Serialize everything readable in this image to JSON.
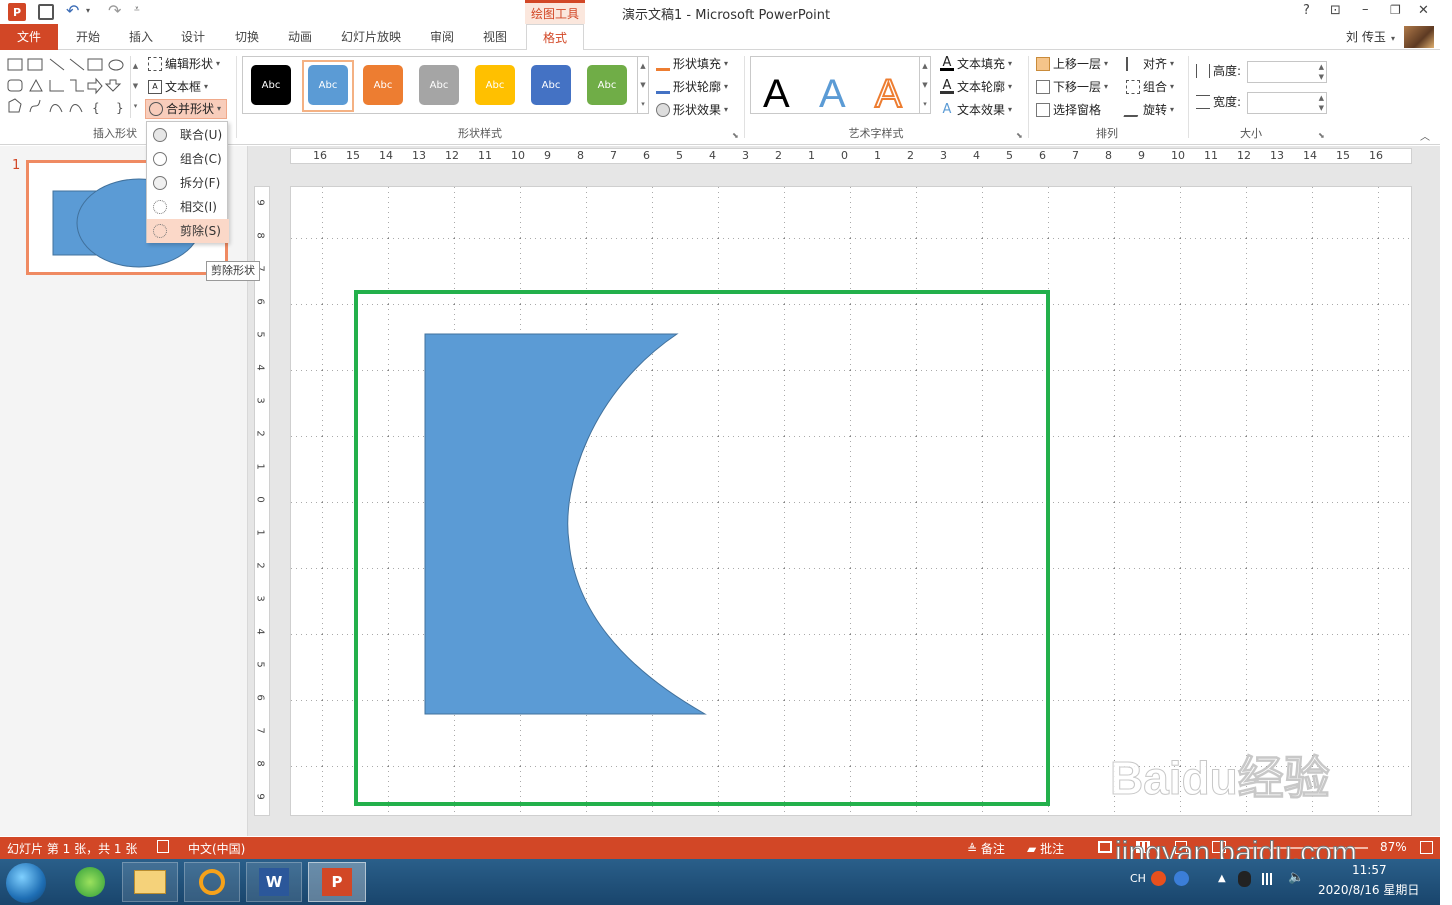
{
  "title": {
    "context_tab": "绘图工具",
    "window_title": "演示文稿1 - Microsoft PowerPoint",
    "help": "?",
    "restore_ribbon": "⊡",
    "minimize": "–",
    "maximize": "❐",
    "close": "✕"
  },
  "tabs": [
    "文件",
    "开始",
    "插入",
    "设计",
    "切换",
    "动画",
    "幻灯片放映",
    "审阅",
    "视图",
    "格式"
  ],
  "user": "刘 传玉",
  "ribbon": {
    "insert_shapes": {
      "label": "插入形状",
      "edit_shape": "编辑形状",
      "text_box": "文本框",
      "merge_shapes": "合并形状"
    },
    "shape_styles": {
      "label": "形状样式",
      "swatch_text": "Abc",
      "fill": "形状填充",
      "outline": "形状轮廓",
      "effects": "形状效果"
    },
    "wordart": {
      "label": "艺术字样式",
      "letter": "A",
      "text_fill": "文本填充",
      "text_outline": "文本轮廓",
      "text_effects": "文本效果"
    },
    "arrange": {
      "label": "排列",
      "bring_forward": "上移一层",
      "send_backward": "下移一层",
      "selection_pane": "选择窗格",
      "align": "对齐",
      "group": "组合",
      "rotate": "旋转"
    },
    "size": {
      "label": "大小",
      "height_label": "高度:",
      "width_label": "宽度:"
    }
  },
  "merge_menu": {
    "items": [
      "联合(U)",
      "组合(C)",
      "拆分(F)",
      "相交(I)",
      "剪除(S)"
    ],
    "tooltip": "剪除形状"
  },
  "slide_panel": {
    "slide_number": "1"
  },
  "hruler": [
    "16",
    "15",
    "14",
    "13",
    "12",
    "11",
    "10",
    "9",
    "8",
    "7",
    "6",
    "5",
    "4",
    "3",
    "2",
    "1",
    "0",
    "1",
    "2",
    "3",
    "4",
    "5",
    "6",
    "7",
    "8",
    "9",
    "10",
    "11",
    "12",
    "13",
    "14",
    "15",
    "16"
  ],
  "vruler": [
    "9",
    "8",
    "7",
    "6",
    "5",
    "4",
    "3",
    "2",
    "1",
    "0",
    "1",
    "2",
    "3",
    "4",
    "5",
    "6",
    "7",
    "8",
    "9"
  ],
  "status": {
    "slide_info": "幻灯片 第 1 张，共 1 张",
    "language": "中文(中国)",
    "notes": "备注",
    "comments": "批注",
    "zoom": "87%"
  },
  "watermark": {
    "brand": "Baidu经验",
    "url": "jingyan.baidu.com"
  },
  "tray": {
    "ime": "CH",
    "time": "11:57",
    "date": "2020/8/16 星期日"
  },
  "colors": {
    "accent": "#d24726",
    "shape_fill": "#5b9bd5",
    "highlight": "#23b04b",
    "swatches": [
      "#000000",
      "#5b9bd5",
      "#ed7d31",
      "#a5a5a5",
      "#ffc000",
      "#4472c4",
      "#70ad47"
    ]
  }
}
